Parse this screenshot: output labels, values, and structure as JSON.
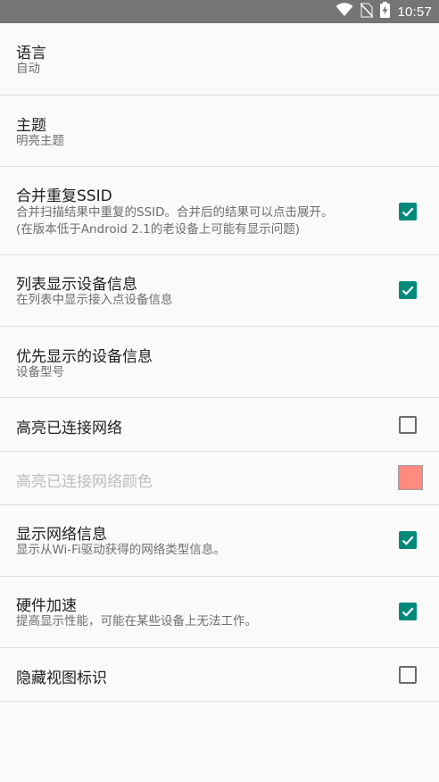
{
  "status_bar": {
    "time": "10:57",
    "icons": [
      "wifi-icon",
      "no-sim-icon",
      "battery-charging-icon"
    ]
  },
  "settings": [
    {
      "title": "语言",
      "summary": "自动"
    },
    {
      "title": "主题",
      "summary": "明亮主题"
    },
    {
      "title": "合并重复SSID",
      "summary_line1": "合并扫描结果中重复的SSID。合并后的结果可以点击展开。",
      "summary_line2": "(在版本低于Android 2.1的老设备上可能有显示问题)",
      "checked": true
    },
    {
      "title": "列表显示设备信息",
      "summary": "在列表中显示接入点设备信息",
      "checked": true
    },
    {
      "title": "优先显示的设备信息",
      "summary": "设备型号"
    },
    {
      "title": "高亮已连接网络",
      "checked": false
    },
    {
      "title": "高亮已连接网络颜色",
      "enabled": false,
      "color": "#ff8a80"
    },
    {
      "title": "显示网络信息",
      "summary": "显示从Wi-Fi驱动获得的网络类型信息。",
      "checked": true
    },
    {
      "title": "硬件加速",
      "summary": "提高显示性能，可能在某些设备上无法工作。",
      "checked": true
    },
    {
      "title": "隐藏视图标识",
      "checked": false
    }
  ],
  "colors": {
    "accent": "#00897b",
    "status_bar": "#757575",
    "background": "#fafafa"
  }
}
